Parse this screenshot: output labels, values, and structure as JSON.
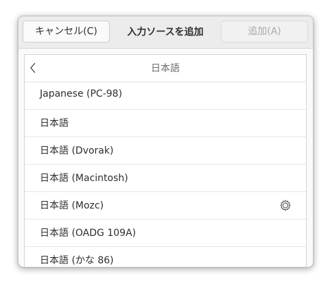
{
  "header": {
    "cancel_label": "キャンセル(C)",
    "title": "入力ソースを追加",
    "add_label": "追加(A)"
  },
  "list": {
    "title": "日本語",
    "back_icon": "chevron-left-icon",
    "items": [
      {
        "label": "Japanese (PC-98)",
        "settings": false
      },
      {
        "label": "日本語",
        "settings": false
      },
      {
        "label": "日本語 (Dvorak)",
        "settings": false
      },
      {
        "label": "日本語 (Macintosh)",
        "settings": false
      },
      {
        "label": "日本語 (Mozc)",
        "settings": true,
        "settings_icon": "gear-icon"
      },
      {
        "label": "日本語 (OADG 109A)",
        "settings": false
      },
      {
        "label": "日本語 (かな 86)",
        "settings": false
      }
    ]
  },
  "colors": {
    "headerbar_bg": "#ececec",
    "disabled_text": "#a9a9a9",
    "text": "#2e2e2e",
    "muted_text": "#6a6a6a"
  }
}
